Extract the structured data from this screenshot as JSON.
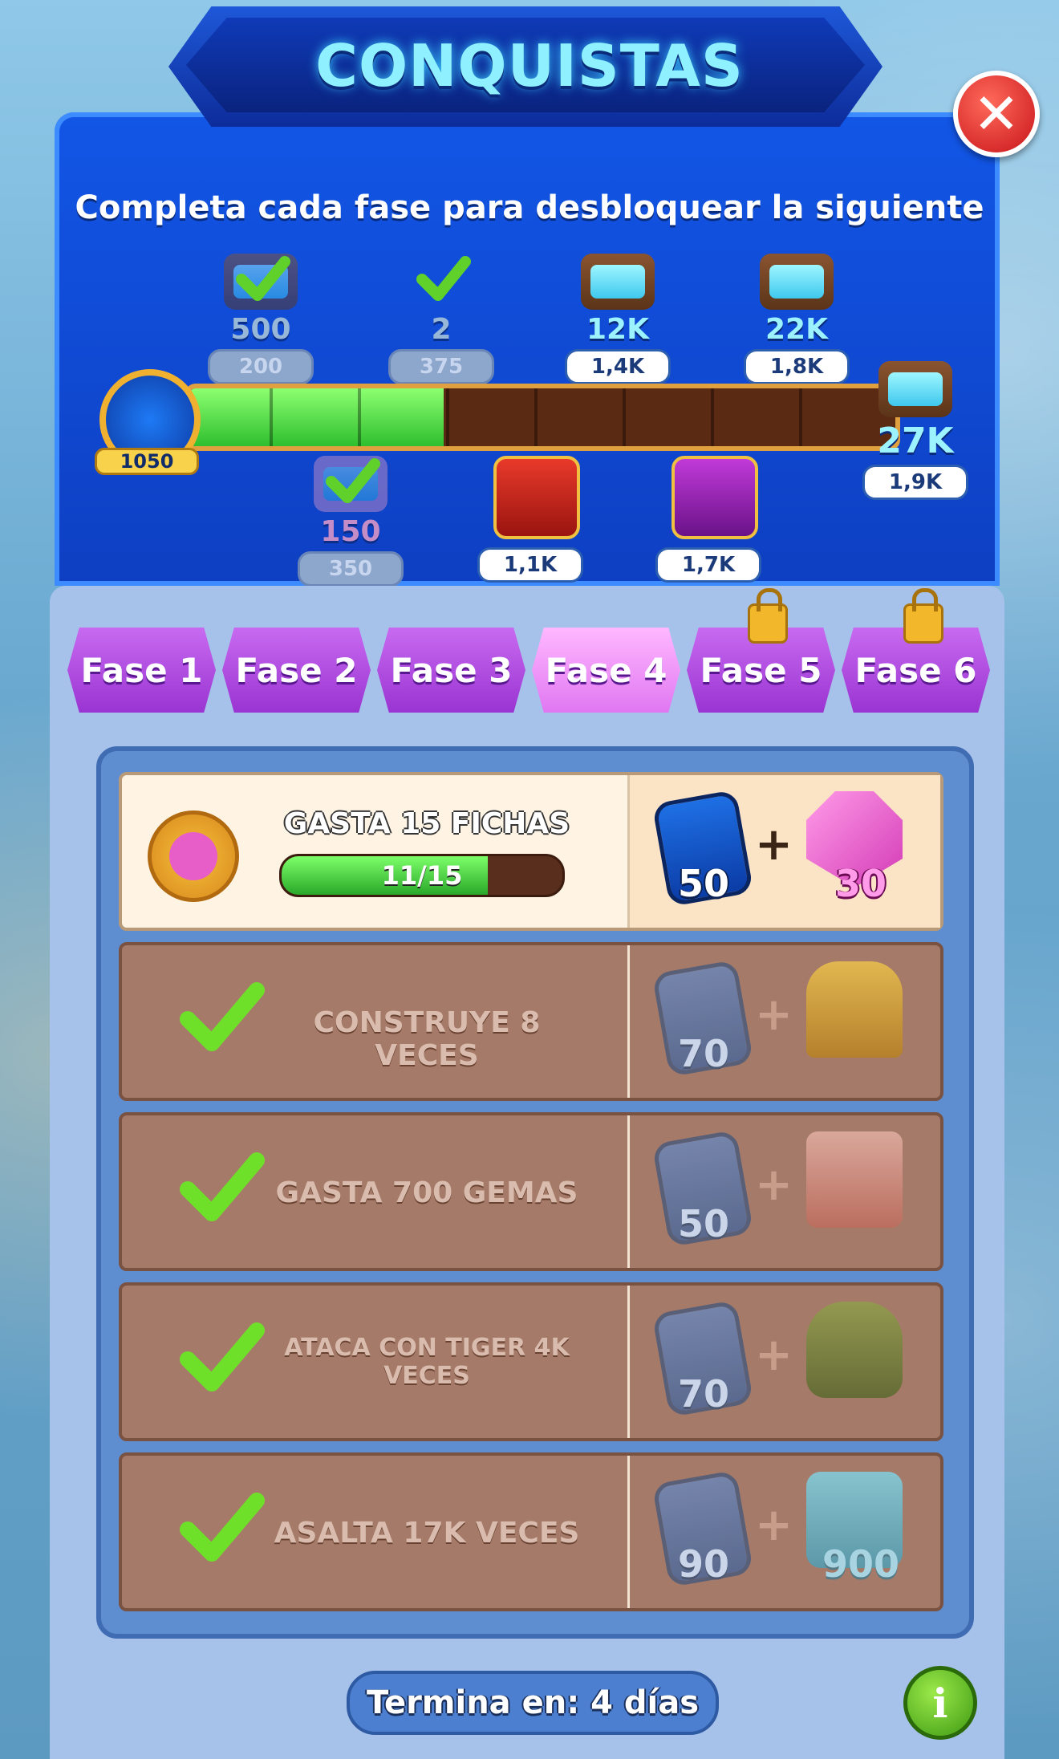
{
  "header": {
    "title": "CONQUISTAS"
  },
  "subtitle": "Completa cada fase para desbloquear la siguiente",
  "track": {
    "token_count": "1050",
    "progress_fraction": 0.36,
    "top_rewards": [
      {
        "amount": "500",
        "cost": "200",
        "claimed": true
      },
      {
        "amount": "2",
        "cost": "375",
        "claimed": true
      },
      {
        "amount": "12K",
        "cost": "1,4K",
        "claimed": false
      },
      {
        "amount": "22K",
        "cost": "1,8K",
        "claimed": false
      },
      {
        "amount": "27K",
        "cost": "1,9K",
        "claimed": false
      }
    ],
    "bottom_rewards": [
      {
        "amount": "150",
        "cost": "350",
        "claimed": true
      },
      {
        "amount": "",
        "cost": "1,1K",
        "claimed": false
      },
      {
        "amount": "",
        "cost": "1,7K",
        "claimed": false
      }
    ]
  },
  "tabs": [
    {
      "label": "Fase 1",
      "locked": false,
      "active": false
    },
    {
      "label": "Fase 2",
      "locked": false,
      "active": false
    },
    {
      "label": "Fase 3",
      "locked": false,
      "active": false
    },
    {
      "label": "Fase 4",
      "locked": false,
      "active": true
    },
    {
      "label": "Fase 5",
      "locked": true,
      "active": false
    },
    {
      "label": "Fase 6",
      "locked": true,
      "active": false
    }
  ],
  "tasks": [
    {
      "title": "GASTA 15 FICHAS",
      "progress": "11/15",
      "progress_fraction": 0.733,
      "token_reward": "50",
      "item_reward": "30",
      "item_icon": "gem-icon",
      "done": false
    },
    {
      "title": "CONSTRUYE 8 VECES",
      "token_reward": "70",
      "item_reward": "",
      "item_icon": "golden-sphinx-icon",
      "done": true
    },
    {
      "title": "GASTA 700 GEMAS",
      "token_reward": "50",
      "item_reward": "",
      "item_icon": "gift-box-icon",
      "done": true
    },
    {
      "title": "ATACA CON TIGER 4K VECES",
      "token_reward": "70",
      "item_reward": "",
      "item_icon": "lantern-icon",
      "done": true
    },
    {
      "title": "ASALTA 17K VECES",
      "token_reward": "90",
      "item_reward": "900",
      "item_icon": "chest-icon",
      "done": true
    }
  ],
  "footer": {
    "ends_in": "Termina en: 4 días",
    "info_label": "i"
  },
  "colors": {
    "tab_purple": "#9a34d2",
    "active_tab": "#e077f2",
    "panel_blue": "#0e3fc2",
    "progress_green": "#2fbf2f"
  }
}
